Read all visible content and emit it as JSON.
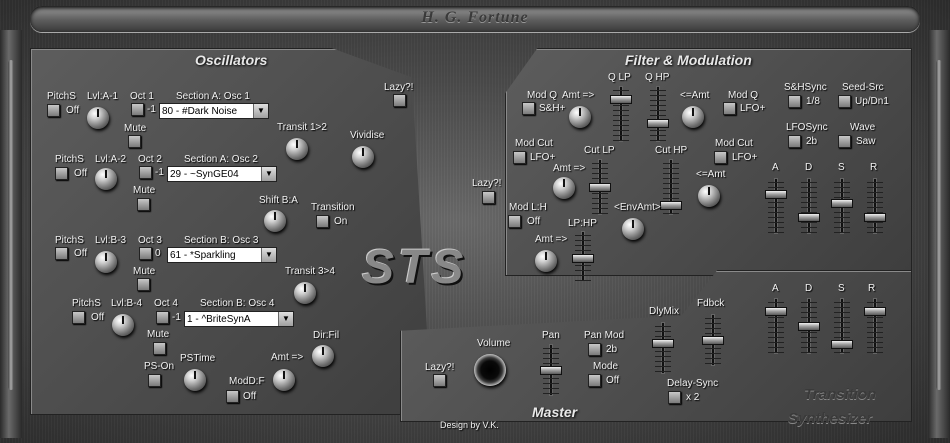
{
  "app_title": "H. G. Fortune",
  "logo": "STS",
  "credit": "Design by V.K.",
  "brand": {
    "line1": "Transition",
    "line2": "Synthesizer"
  },
  "sections": {
    "osc": "Oscillators",
    "filter": "Filter & Modulation",
    "master": "Master"
  },
  "osc": {
    "row1": {
      "pitchs": "PitchS",
      "off": "Off",
      "lvl": "Lvl:A-1",
      "oct": "Oct 1",
      "oct_val": "-1",
      "sec": "Section A: Osc 1",
      "sel": "80 - #Dark Noise",
      "mute": "Mute"
    },
    "row2": {
      "pitchs": "PitchS",
      "off": "Off",
      "lvl": "Lvl:A-2",
      "oct": "Oct 2",
      "oct_val": "-1",
      "sec": "Section A: Osc 2",
      "sel": "29 - ~SynGE04",
      "mute": "Mute"
    },
    "row3": {
      "pitchs": "PitchS",
      "off": "Off",
      "lvl": "Lvl:B-3",
      "oct": "Oct 3",
      "oct_val": "0",
      "sec": "Section B: Osc 3",
      "sel": "61 - *Sparkling",
      "mute": "Mute"
    },
    "row4": {
      "pitchs": "PitchS",
      "off": "Off",
      "lvl": "Lvl:B-4",
      "oct": "Oct 4",
      "oct_val": "-1",
      "sec": "Section B: Osc 4",
      "sel": "1 - ^BriteSynA",
      "mute": "Mute"
    },
    "lazy": "Lazy?!",
    "transit12": "Transit 1>2",
    "vividise": "Vividise",
    "shiftba": "Shift B:A",
    "transition": "Transition",
    "transition_val": "On",
    "transit34": "Transit 3>4",
    "dirfil": "Dir:Fil",
    "amt": "Amt =>",
    "ps_on": "PS-On",
    "pstime": "PSTime",
    "modd": "ModD:F",
    "modd_val": "Off"
  },
  "filter": {
    "modq": "Mod Q",
    "modq_val": "S&H+",
    "amt1": "Amt =>",
    "qlp": "Q LP",
    "qhp": "Q HP",
    "amt2": "<=Amt",
    "modq2": "Mod Q",
    "modq2_val": "LFO+",
    "shsync": "S&HSync",
    "shsync_val": "1/8",
    "seed": "Seed-Src",
    "seed_val": "Up/Dn1",
    "lfosync": "LFOSync",
    "lfosync_val": "2b",
    "wave": "Wave",
    "wave_val": "Saw",
    "modcut": "Mod Cut",
    "modcut_val": "LFO+",
    "amt3": "Amt =>",
    "cutlp": "Cut LP",
    "cuthp": "Cut HP",
    "modcut2": "Mod Cut",
    "modcut2_val": "LFO+",
    "amt4": "<=Amt",
    "lazy": "Lazy?!",
    "modlh": "Mod L:H",
    "modlh_val": "Off",
    "envamt": "<EnvAmt>",
    "amt5": "Amt =>",
    "lphp": "LP:HP",
    "adsr": [
      "A",
      "D",
      "S",
      "R"
    ]
  },
  "master": {
    "lazy": "Lazy?!",
    "volume": "Volume",
    "pan": "Pan",
    "panmod": "Pan Mod",
    "panmod_val": "2b",
    "mode": "Mode",
    "mode_val": "Off",
    "dlymix": "DlyMix",
    "fdbck": "Fdbck",
    "delaysync": "Delay-Sync",
    "delaysync_val": "x 2",
    "adsr": [
      "A",
      "D",
      "S",
      "R"
    ]
  },
  "sliders": {
    "q_lp": 0.8,
    "q_hp": 0.3,
    "cut_lp": 0.5,
    "cut_hp": 0.1,
    "lphp": 0.45,
    "filter_a": 0.75,
    "filter_d": 0.25,
    "filter_s": 0.55,
    "filter_r": 0.25,
    "pan": 0.5,
    "dlymix": 0.6,
    "fdbck": 0.5,
    "master_a": 0.8,
    "master_d": 0.5,
    "master_s": 0.1,
    "master_r": 0.8
  }
}
